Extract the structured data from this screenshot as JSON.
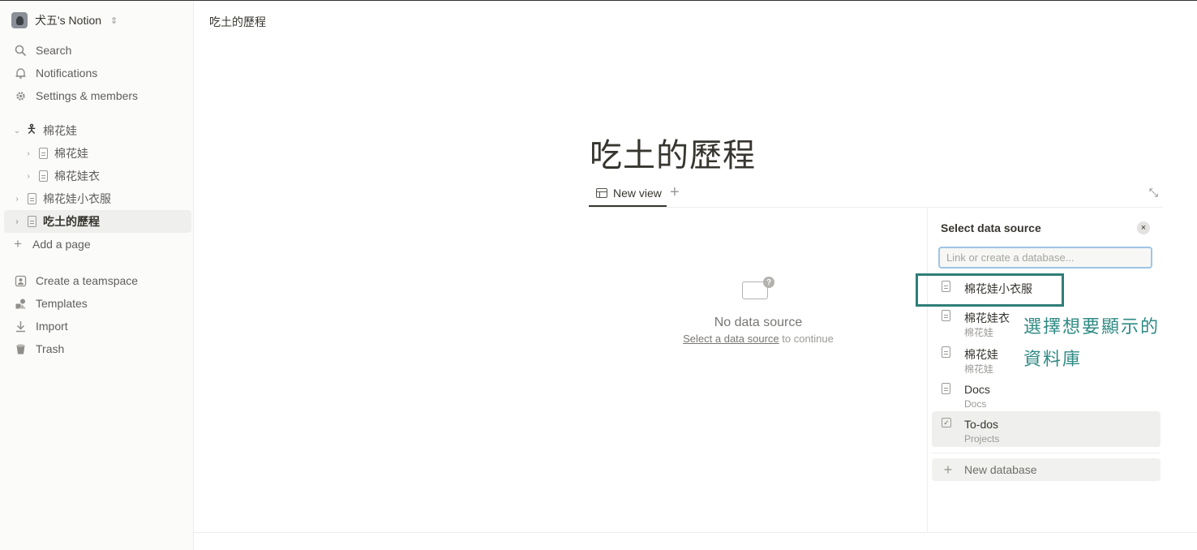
{
  "sidebar": {
    "workspace_name": "犬五's Notion",
    "menu": [
      {
        "label": "Search",
        "icon": "search-icon"
      },
      {
        "label": "Notifications",
        "icon": "bell-icon"
      },
      {
        "label": "Settings & members",
        "icon": "gear-icon"
      }
    ],
    "pages": [
      {
        "label": "棉花娃",
        "icon": "person-icon",
        "level": 0,
        "expanded": true
      },
      {
        "label": "棉花娃",
        "icon": "page-icon",
        "level": 1
      },
      {
        "label": "棉花娃衣",
        "icon": "page-icon",
        "level": 1
      },
      {
        "label": "棉花娃小衣服",
        "icon": "page-icon",
        "level": 0
      },
      {
        "label": "吃土的歷程",
        "icon": "page-icon",
        "level": 0,
        "active": true
      }
    ],
    "add_page": "Add a page",
    "bottom": [
      {
        "label": "Create a teamspace",
        "icon": "teamspace-icon"
      },
      {
        "label": "Templates",
        "icon": "templates-icon"
      },
      {
        "label": "Import",
        "icon": "import-icon"
      },
      {
        "label": "Trash",
        "icon": "trash-icon"
      }
    ]
  },
  "topbar": {
    "breadcrumb": "吃土的歷程"
  },
  "page": {
    "title": "吃土的歷程",
    "view_tab": "New view",
    "empty_title": "No data source",
    "empty_link": "Select a data source",
    "empty_suffix": " to continue"
  },
  "panel": {
    "title": "Select data source",
    "close_icon": "×",
    "search_placeholder": "Link or create a database...",
    "items": [
      {
        "name": "棉花娃小衣服",
        "sub": "",
        "icon": "page-icon"
      },
      {
        "name": "棉花娃衣",
        "sub": "棉花娃",
        "icon": "page-icon"
      },
      {
        "name": "棉花娃",
        "sub": "棉花娃",
        "icon": "page-icon"
      },
      {
        "name": "Docs",
        "sub": "Docs",
        "icon": "docs-icon"
      },
      {
        "name": "To-dos",
        "sub": "Projects",
        "icon": "checkbox-icon"
      }
    ],
    "new_database": "New database"
  },
  "annotation": {
    "line1": "選擇想要顯示的",
    "line2": "資料庫",
    "color": "#2f8a84"
  }
}
